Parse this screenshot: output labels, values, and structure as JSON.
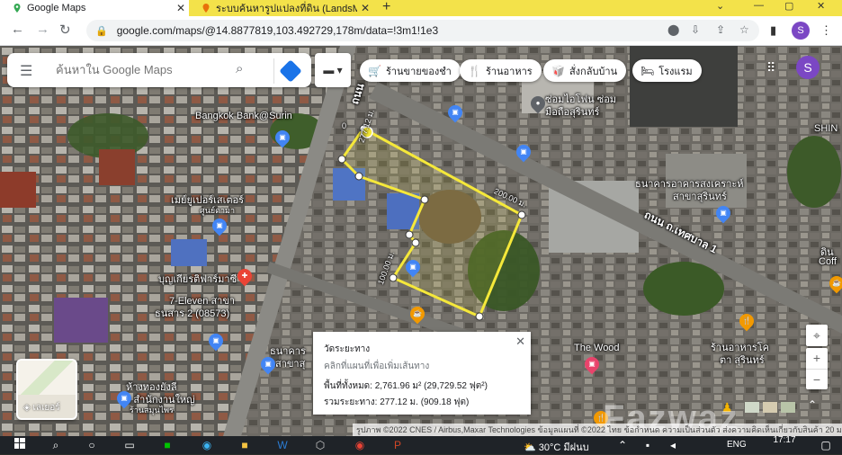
{
  "browser": {
    "tabs": [
      {
        "title": "Google Maps",
        "active": true
      },
      {
        "title": "ระบบค้นหารูปแปลงที่ดิน (LandsMaps)",
        "active": false
      }
    ],
    "url": "google.com/maps/@14.8877819,103.492729,178m/data=!3m1!1e3",
    "profile_initial": "S"
  },
  "search": {
    "placeholder": "ค้นหาใน Google Maps"
  },
  "chips": [
    {
      "label": "ร้านขายของชำ",
      "icon": "cart-icon"
    },
    {
      "label": "ร้านอาหาร",
      "icon": "restaurant-icon"
    },
    {
      "label": "สั่งกลับบ้าน",
      "icon": "takeout-icon"
    },
    {
      "label": "โรงแรม",
      "icon": "hotel-icon"
    }
  ],
  "map_avatar": "S",
  "map_labels": {
    "bangkok_bank": "Bangkok Bank@Surin",
    "phone_shop": "ซ่อมไอโฟน ซ่อม",
    "phone_shop2": "มือถือสุรินทร์",
    "shin": "SHIN",
    "bank_gh": "ธนาคารอาคารสงเคราะห์",
    "bank_gh2": "สาขาสุรินทร์",
    "road_thesaban": "ถนน ถ.เทศบาล 1",
    "road_vertical": "ถนน",
    "super": "เมย์ยูเปอร์เสเตอร์",
    "super2": "ศูนย์ดามา",
    "boonyiat": "บุญเกียรติฟาร์มาซี",
    "seven": "7-Eleven สาขา",
    "seven2": "ธนสาร 2 (08573)",
    "department": "ห้างทองยังลี",
    "department2": "ง สำนักงานใหญ่",
    "department3": "ร้านสมุนไพร",
    "the_wood": "The Wood",
    "restaurant_r": "ร้านอาหารโค",
    "restaurant_r2": "ตา สุรินทร์",
    "coff": "ดิน",
    "coff2": "Coff",
    "bank_small": "ธนาคาร",
    "bank_small2": "สาขาสุ",
    "dist_200": "200.00 ม.",
    "dist_100": "100.00 ม.",
    "dist_277": "277.12 ม.",
    "dist_0": "0"
  },
  "measure": {
    "title": "วัดระยะทาง",
    "hint": "คลิกที่แผนที่เพื่อเพิ่มเส้นทาง",
    "area": "พื้นที่ทั้งหมด: 2,761.96 ม² (29,729.52 ฟุต²)",
    "distance": "รวมระยะทาง: 277.12 ม. (909.18 ฟุต)"
  },
  "layers_label": "เลเยอร์",
  "attribution": "รูปภาพ ©2022 CNES / Airbus,Maxar Technologies ข้อมูลแผนที่ ©2022   ไทย   ข้อกำหนด   ความเป็นส่วนตัว   ส่งความคิดเห็นเกี่ยวกับสินค้า   20 ม.",
  "watermark": "Fazwaz",
  "taskbar": {
    "weather": "30°C  มีฝนบ",
    "lang": "ENG",
    "time": "17:17"
  },
  "colors": {
    "tab_bar": "#f3e24a",
    "measure_line": "#f5e83a",
    "pin_blue": "#4285f4",
    "pin_orange": "#f29900",
    "pin_red": "#ea4335",
    "accent": "#1a73e8",
    "avatar": "#7b47c4"
  }
}
